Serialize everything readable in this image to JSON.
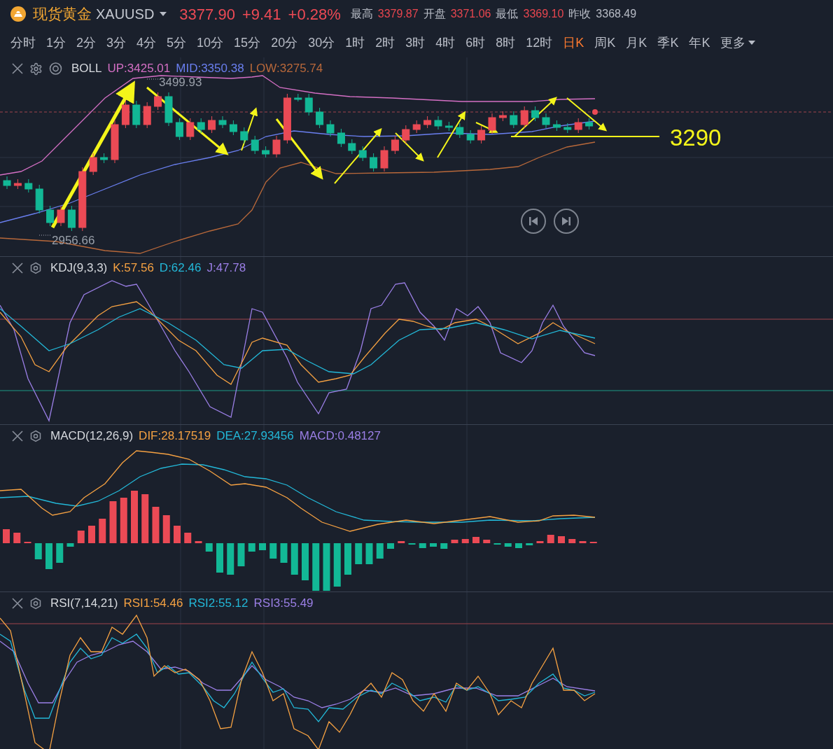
{
  "header": {
    "name": "现货黄金",
    "symbol": "XAUUSD",
    "price": "3377.90",
    "change": "+9.41",
    "change_pct": "+0.28%",
    "stats": [
      {
        "label": "最高",
        "value": "3379.87",
        "color": "#e8464f"
      },
      {
        "label": "开盘",
        "value": "3371.06",
        "color": "#e8464f"
      },
      {
        "label": "最低",
        "value": "3369.10",
        "color": "#e8464f"
      },
      {
        "label": "昨收",
        "value": "3368.49",
        "color": "#b8bcc6"
      }
    ]
  },
  "timeframes": [
    {
      "label": "分时",
      "selected": false
    },
    {
      "label": "1分",
      "selected": false
    },
    {
      "label": "2分",
      "selected": false
    },
    {
      "label": "3分",
      "selected": false
    },
    {
      "label": "4分",
      "selected": false
    },
    {
      "label": "5分",
      "selected": false
    },
    {
      "label": "10分",
      "selected": false
    },
    {
      "label": "15分",
      "selected": false
    },
    {
      "label": "20分",
      "selected": false
    },
    {
      "label": "30分",
      "selected": false
    },
    {
      "label": "1时",
      "selected": false
    },
    {
      "label": "2时",
      "selected": false
    },
    {
      "label": "3时",
      "selected": false
    },
    {
      "label": "4时",
      "selected": false
    },
    {
      "label": "6时",
      "selected": false
    },
    {
      "label": "8时",
      "selected": false
    },
    {
      "label": "12时",
      "selected": false
    },
    {
      "label": "日K",
      "selected": true
    },
    {
      "label": "周K",
      "selected": false
    },
    {
      "label": "月K",
      "selected": false
    },
    {
      "label": "季K",
      "selected": false
    },
    {
      "label": "年K",
      "selected": false
    },
    {
      "label": "更多",
      "selected": false,
      "kind": "menu"
    }
  ],
  "panels": [
    {
      "kind": "boll",
      "name": "BOLL",
      "values": [
        {
          "text": "UP:3425.01",
          "color": "#d46fc4"
        },
        {
          "text": "MID:3350.38",
          "color": "#6a7ff0"
        },
        {
          "text": "LOW:3275.74",
          "color": "#b8683a"
        }
      ],
      "high_label": "3499.93",
      "low_label": "2956.66",
      "target_label": "3290"
    },
    {
      "kind": "kdj",
      "name": "KDJ(9,3,3)",
      "values": [
        {
          "text": "K:57.56",
          "color": "#f5a142"
        },
        {
          "text": "D:62.46",
          "color": "#23b8d8"
        },
        {
          "text": "J:47.78",
          "color": "#9b7fe6"
        }
      ]
    },
    {
      "kind": "macd",
      "name": "MACD(12,26,9)",
      "values": [
        {
          "text": "DIF:28.17519",
          "color": "#f5a142"
        },
        {
          "text": "DEA:27.93456",
          "color": "#23b8d8"
        },
        {
          "text": "MACD:0.48127",
          "color": "#9b7fe6"
        }
      ]
    },
    {
      "kind": "rsi",
      "name": "RSI(7,14,21)",
      "values": [
        {
          "text": "RSI1:54.46",
          "color": "#f5a142"
        },
        {
          "text": "RSI2:55.12",
          "color": "#23b8d8"
        },
        {
          "text": "RSI3:55.49",
          "color": "#9b7fe6"
        }
      ]
    }
  ]
}
